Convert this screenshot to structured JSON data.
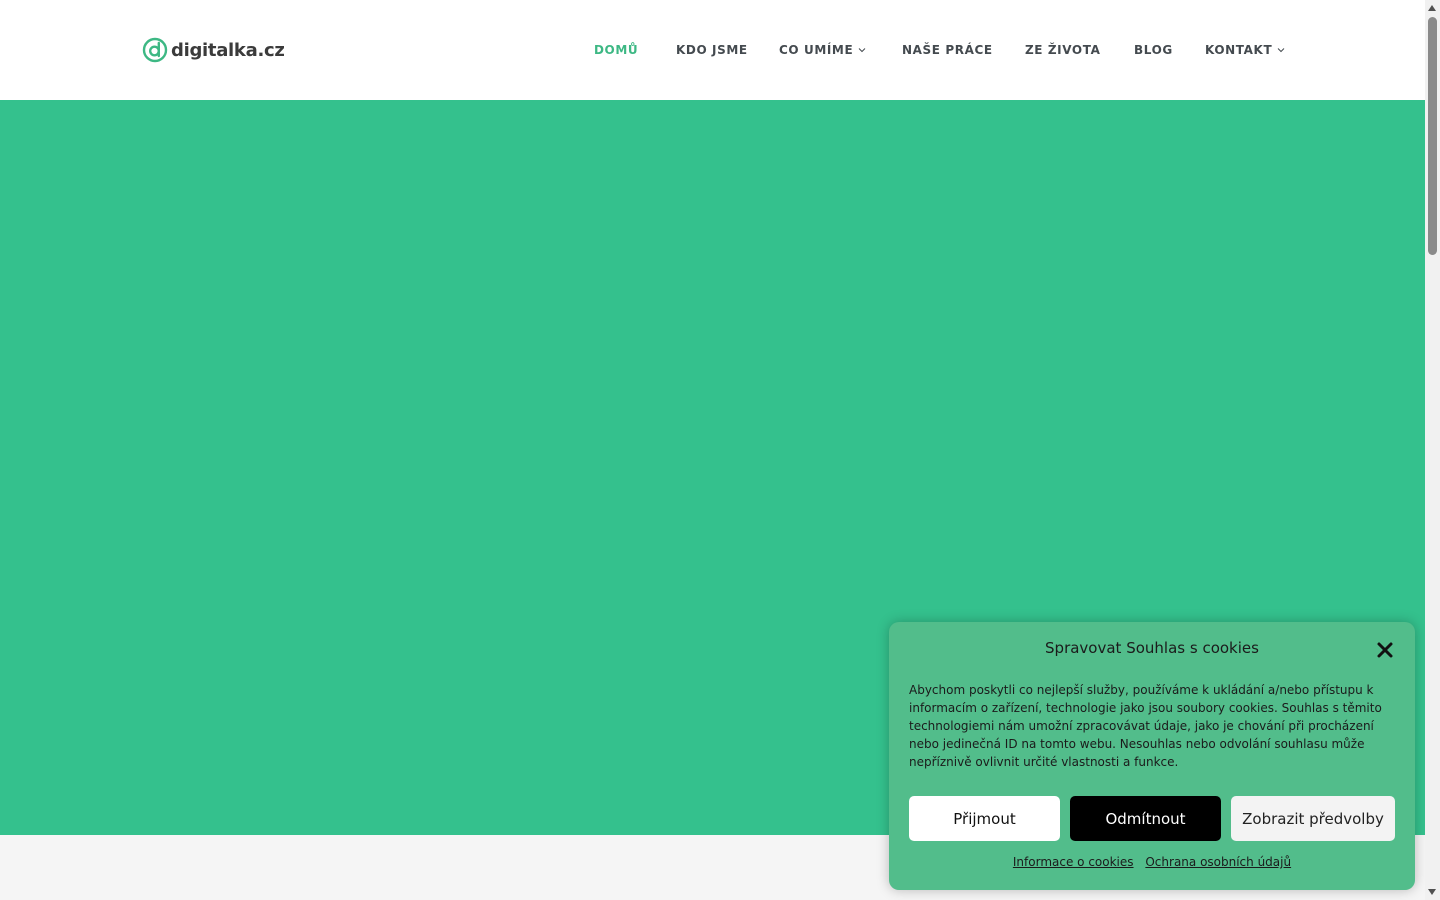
{
  "header": {
    "logo_text": "digitalka.cz",
    "logo_icon": "digitalka-logo-icon",
    "nav": [
      {
        "label": "DOMŮ",
        "active": true,
        "has_dropdown": false
      },
      {
        "label": "KDO JSME",
        "active": false,
        "has_dropdown": false
      },
      {
        "label": "CO UMÍME",
        "active": false,
        "has_dropdown": true
      },
      {
        "label": "NAŠE PRÁCE",
        "active": false,
        "has_dropdown": false
      },
      {
        "label": "ZE ŽIVOTA",
        "active": false,
        "has_dropdown": false
      },
      {
        "label": "BLOG",
        "active": false,
        "has_dropdown": false
      },
      {
        "label": "KONTAKT",
        "active": false,
        "has_dropdown": true
      }
    ]
  },
  "colors": {
    "accent": "#3db884",
    "hero": "#34c18d",
    "cookie_dialog": "#52bd8b"
  },
  "cookie": {
    "title": "Spravovat Souhlas s cookies",
    "close_icon": "close-icon",
    "text": "Abychom poskytli co nejlepší služby, používáme k ukládání a/nebo přístupu k informacím o zařízení, technologie jako jsou soubory cookies. Souhlas s těmito technologiemi nám umožní zpracovávat údaje, jako je chování při procházení nebo jedinečná ID na tomto webu. Nesouhlas nebo odvolání souhlasu může nepříznivě ovlivnit určité vlastnosti a funkce.",
    "accept": "Přijmout",
    "deny": "Odmítnout",
    "preferences": "Zobrazit předvolby",
    "links": {
      "cookies_info": "Informace o cookies",
      "privacy": "Ochrana osobních údajů"
    }
  }
}
